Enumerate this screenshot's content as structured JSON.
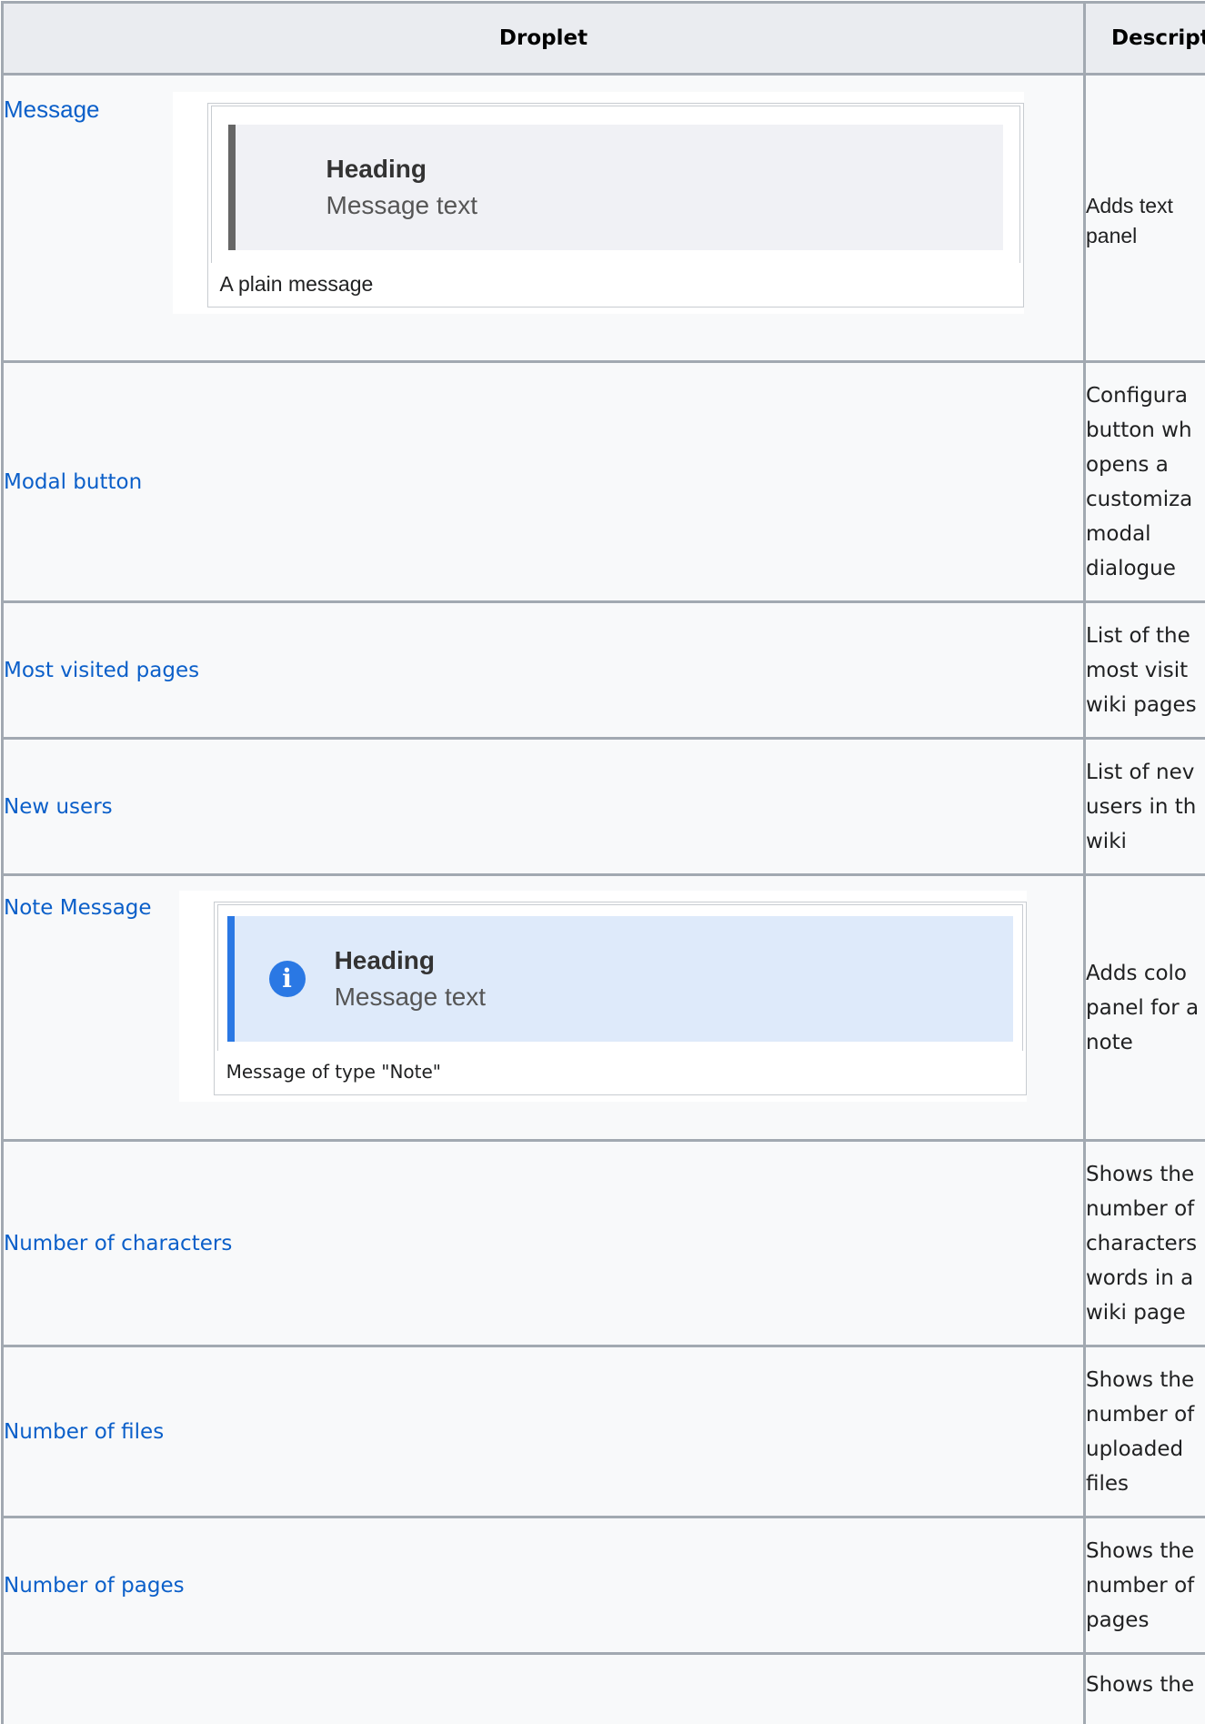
{
  "table": {
    "headers": {
      "droplet": "Droplet",
      "description": "Descript"
    },
    "rows": [
      {
        "name": "Message",
        "description_lines": [
          "Adds text",
          "panel"
        ],
        "figure": {
          "heading": "Heading",
          "text": "Message text",
          "caption": "A plain message"
        }
      },
      {
        "name": "Modal button",
        "description_lines": [
          "Configura",
          "button wh",
          "opens a",
          "customiza",
          "modal",
          "dialogue"
        ]
      },
      {
        "name": "Most visited pages",
        "description_lines": [
          "List of the",
          "most visit",
          "wiki pages"
        ]
      },
      {
        "name": "New users",
        "description_lines": [
          "List of nev",
          "users in th",
          "wiki"
        ]
      },
      {
        "name": "Note Message",
        "description_lines": [
          "Adds colo",
          "panel for a",
          "note"
        ],
        "figure": {
          "icon": "info-icon",
          "heading": "Heading",
          "text": "Message text",
          "caption": "Message of type \"Note\""
        }
      },
      {
        "name": "Number of characters",
        "description_lines": [
          "Shows the",
          "number of",
          "characters",
          "words in a",
          "wiki page"
        ]
      },
      {
        "name": "Number of files",
        "description_lines": [
          "Shows the",
          "number of",
          "uploaded",
          "files"
        ]
      },
      {
        "name": "Number of pages",
        "description_lines": [
          "Shows the",
          "number of",
          "pages"
        ]
      },
      {
        "name": "",
        "description_lines": [
          "Shows the"
        ]
      }
    ]
  },
  "colors": {
    "link": "#0b5fc9",
    "border": "#a2a9b1",
    "header_bg": "#eaecf0",
    "cell_bg": "#f8f9fa",
    "note_accent": "#2a78e4",
    "note_bg": "#deeafa",
    "plain_accent": "#666666",
    "plain_bg": "#f0f1f5"
  }
}
